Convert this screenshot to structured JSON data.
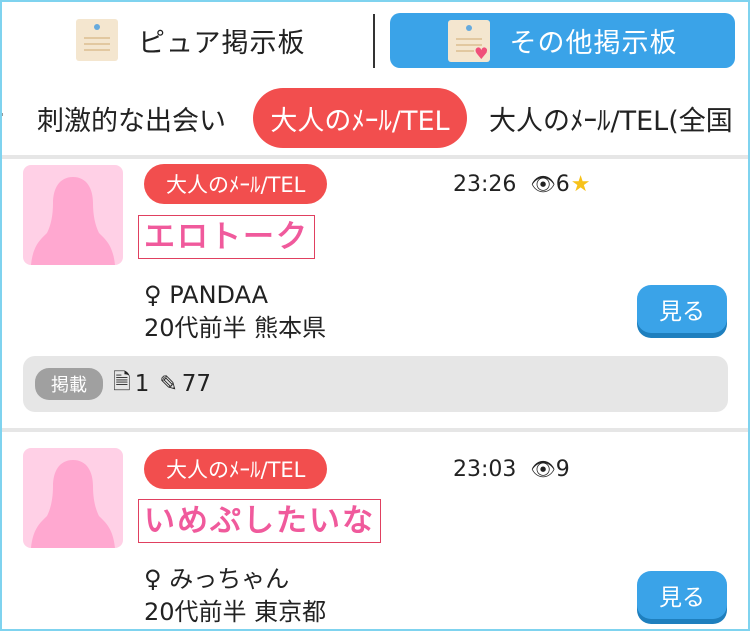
{
  "boards": {
    "pure": {
      "label": "ピュア掲示板"
    },
    "other": {
      "label": "その他掲示板"
    }
  },
  "categories": [
    {
      "label": "刺激的な出会い",
      "active": false
    },
    {
      "label": "大人のﾒｰﾙ/TEL",
      "active": true
    },
    {
      "label": "大人のﾒｰﾙ/TEL(全国",
      "active": false
    }
  ],
  "posts": [
    {
      "tag": "大人のﾒｰﾙ/TEL",
      "time": "23:26",
      "views": "6",
      "starred": true,
      "title": "エロトーク",
      "author": "♀ PANDAA",
      "profile": "20代前半 熊本県",
      "view_label": "見る",
      "badge": "掲載",
      "replies": "1",
      "edits": "77"
    },
    {
      "tag": "大人のﾒｰﾙ/TEL",
      "time": "23:03",
      "views": "9",
      "starred": false,
      "title": "いめぷしたいな",
      "author": "♀ みっちゃん",
      "profile": "20代前半 東京都",
      "view_label": "見る"
    }
  ],
  "colors": {
    "accent_blue": "#3aa3e8",
    "accent_red": "#f24e4e",
    "title_pink": "#f05a9c",
    "avatar_pink": "#ffd0e6"
  },
  "icons": {
    "eye": "eye-icon",
    "star": "star-icon",
    "reply": "document-icon",
    "edit": "edit-icon"
  }
}
